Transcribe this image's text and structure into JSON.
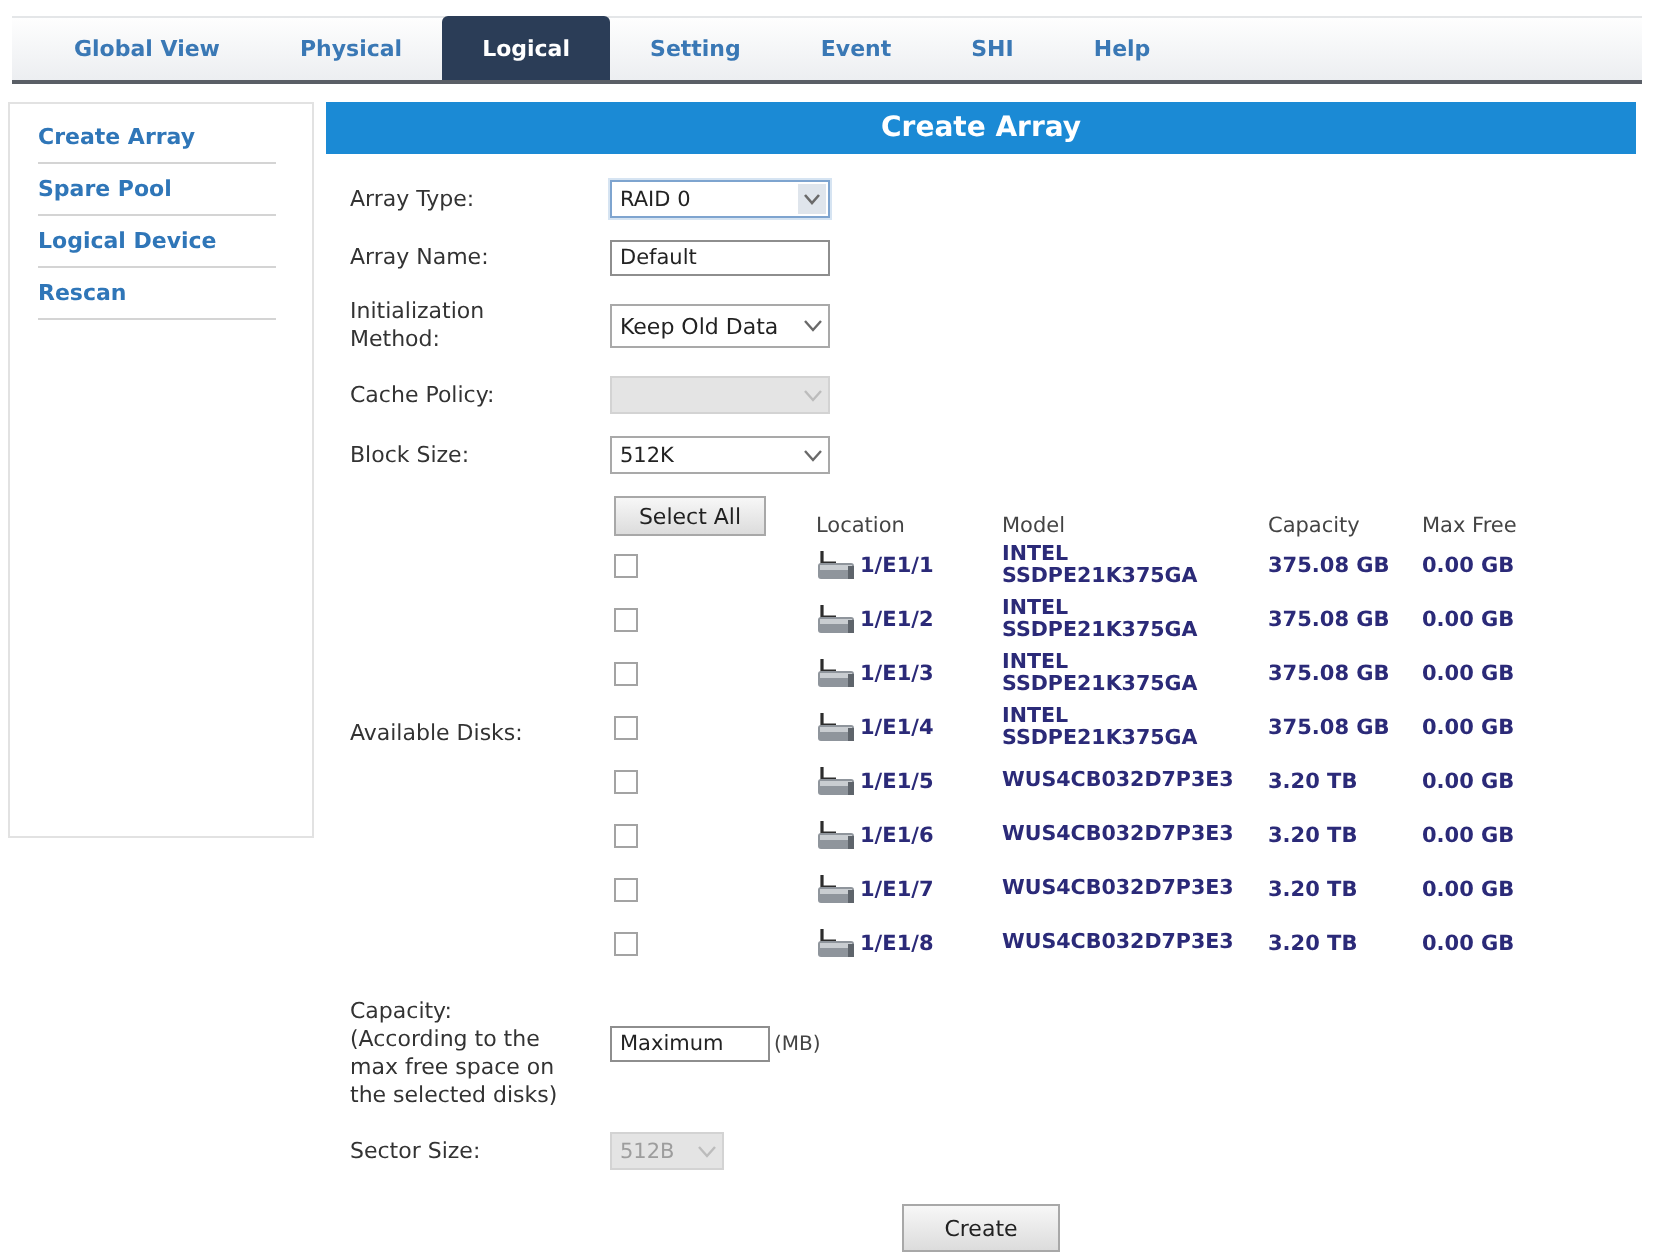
{
  "tabs": [
    {
      "label": "Global View",
      "selected": false
    },
    {
      "label": "Physical",
      "selected": false
    },
    {
      "label": "Logical",
      "selected": true
    },
    {
      "label": "Setting",
      "selected": false
    },
    {
      "label": "Event",
      "selected": false
    },
    {
      "label": "SHI",
      "selected": false
    },
    {
      "label": "Help",
      "selected": false
    }
  ],
  "sidebar": {
    "items": [
      {
        "label": "Create Array"
      },
      {
        "label": "Spare Pool"
      },
      {
        "label": "Logical Device"
      },
      {
        "label": "Rescan"
      }
    ]
  },
  "panel": {
    "title": "Create Array",
    "fields": [
      {
        "kind": "select",
        "label": "Array Type:",
        "value": "RAID 0",
        "disabled": false,
        "focused": true
      },
      {
        "kind": "text",
        "label": "Array Name:",
        "value": "Default",
        "focused": false
      },
      {
        "kind": "select",
        "label": "Initialization Method:",
        "value": "Keep Old Data",
        "disabled": false,
        "focused": false
      },
      {
        "kind": "select",
        "label": "Cache Policy:",
        "disabled": true,
        "focused": false
      },
      {
        "kind": "select",
        "label": "Block Size:",
        "value": "512K",
        "disabled": false,
        "focused": false
      },
      {
        "kind": "disks",
        "label": "Available Disks:",
        "select_all": "Select All",
        "columns": [
          "Location",
          "Model",
          "Capacity",
          "Max Free"
        ],
        "rows": [
          {
            "checked": false,
            "location": "1/E1/1",
            "model": "INTEL SSDPE21K375GA",
            "capacity": "375.08 GB",
            "max_free": "0.00 GB"
          },
          {
            "checked": false,
            "location": "1/E1/2",
            "model": "INTEL SSDPE21K375GA",
            "capacity": "375.08 GB",
            "max_free": "0.00 GB"
          },
          {
            "checked": false,
            "location": "1/E1/3",
            "model": "INTEL SSDPE21K375GA",
            "capacity": "375.08 GB",
            "max_free": "0.00 GB"
          },
          {
            "checked": false,
            "location": "1/E1/4",
            "model": "INTEL SSDPE21K375GA",
            "capacity": "375.08 GB",
            "max_free": "0.00 GB"
          },
          {
            "checked": false,
            "location": "1/E1/5",
            "model": "WUS4CB032D7P3E3",
            "capacity": "3.20 TB",
            "max_free": "0.00 GB"
          },
          {
            "checked": false,
            "location": "1/E1/6",
            "model": "WUS4CB032D7P3E3",
            "capacity": "3.20 TB",
            "max_free": "0.00 GB"
          },
          {
            "checked": false,
            "location": "1/E1/7",
            "model": "WUS4CB032D7P3E3",
            "capacity": "3.20 TB",
            "max_free": "0.00 GB"
          },
          {
            "checked": false,
            "location": "1/E1/8",
            "model": "WUS4CB032D7P3E3",
            "capacity": "3.20 TB",
            "max_free": "0.00 GB"
          }
        ]
      },
      {
        "kind": "text",
        "label": "Capacity:",
        "note": "(According to the max free space on the selected disks)",
        "value": "Maximum",
        "unit": "(MB)",
        "focused": false
      },
      {
        "kind": "select",
        "label": "Sector Size:",
        "value": "512B",
        "disabled": true,
        "focused": false
      }
    ],
    "submit": "Create"
  }
}
